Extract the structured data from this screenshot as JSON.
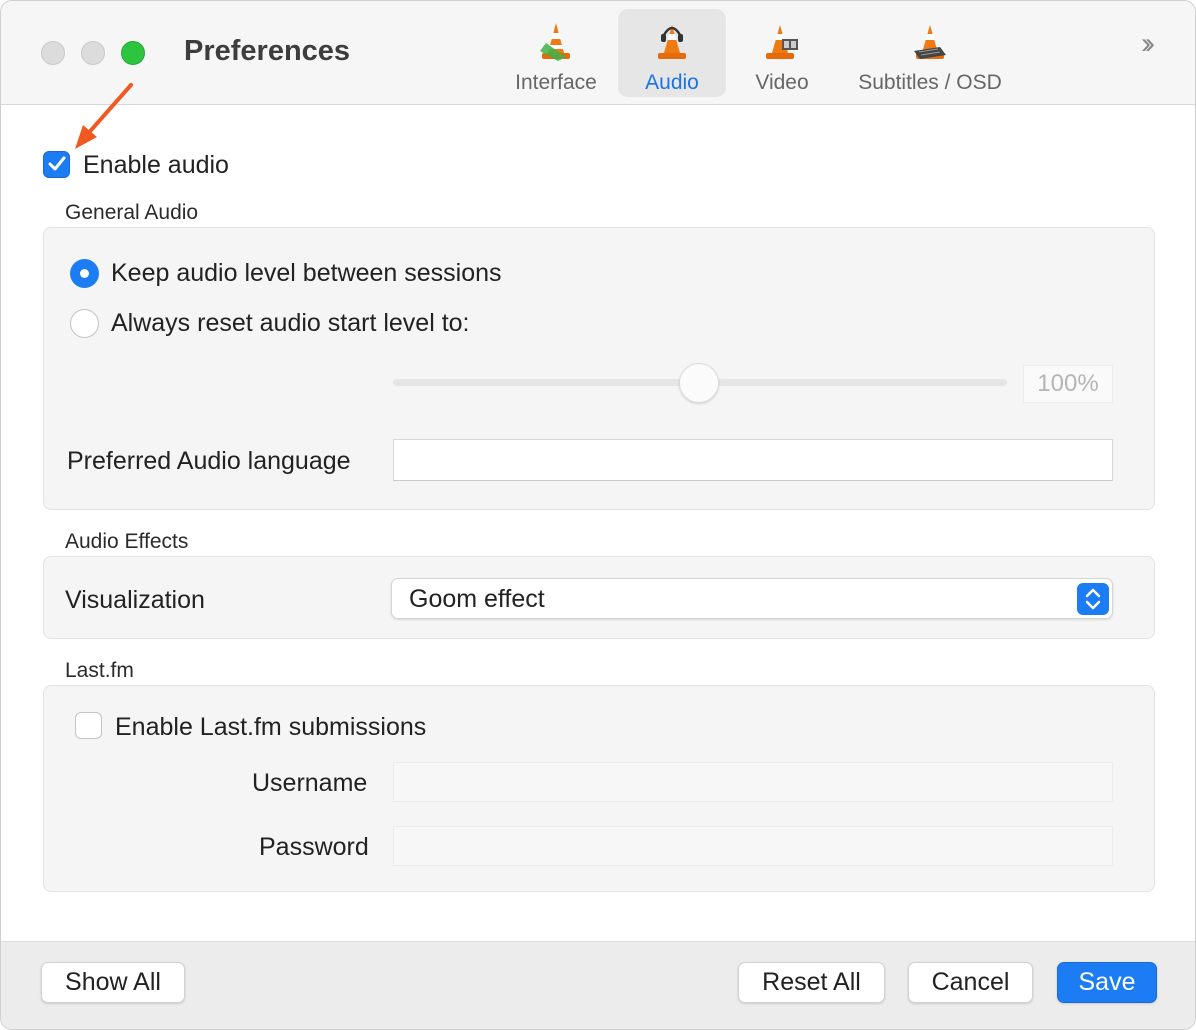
{
  "window": {
    "title": "Preferences"
  },
  "tabs": [
    {
      "label": "Interface",
      "icon": "vlc-cone-icon",
      "active": false
    },
    {
      "label": "Audio",
      "icon": "vlc-cone-headphones-icon",
      "active": true
    },
    {
      "label": "Video",
      "icon": "vlc-cone-film-icon",
      "active": false
    },
    {
      "label": "Subtitles / OSD",
      "icon": "vlc-cone-keyboard-icon",
      "active": false
    }
  ],
  "enable_audio": {
    "label": "Enable audio",
    "checked": true
  },
  "general_audio": {
    "title": "General Audio",
    "option_keep": "Keep audio level between sessions",
    "option_reset": "Always reset audio start level to:",
    "selected_option": "keep",
    "start_level_text": "100%",
    "start_level_fraction": 0.5,
    "preferred_language_label": "Preferred Audio language",
    "preferred_language_value": ""
  },
  "audio_effects": {
    "title": "Audio Effects",
    "visualization_label": "Visualization",
    "visualization_value": "Goom effect"
  },
  "lastfm": {
    "title": "Last.fm",
    "enable_label": "Enable Last.fm submissions",
    "enabled": false,
    "username_label": "Username",
    "username_value": "",
    "password_label": "Password",
    "password_value": ""
  },
  "footer": {
    "show_all": "Show All",
    "reset_all": "Reset All",
    "cancel": "Cancel",
    "save": "Save"
  },
  "colors": {
    "accent": "#1c7cf4",
    "annotation_arrow": "#f05a22",
    "traffic_green": "#2dc43f"
  }
}
